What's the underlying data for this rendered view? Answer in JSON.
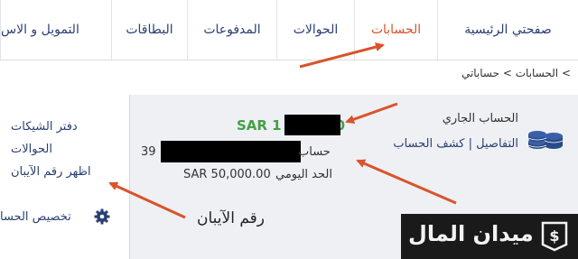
{
  "nav": {
    "items": [
      {
        "label": "صفحتي الرئيسية",
        "active": false
      },
      {
        "label": "الحسابات",
        "active": true
      },
      {
        "label": "الحوالات",
        "active": false
      },
      {
        "label": "المدفوعات",
        "active": false
      },
      {
        "label": "البطاقات",
        "active": false
      },
      {
        "label": "التمويل و الاس",
        "active": false
      }
    ]
  },
  "breadcrumb": {
    "text": "> الحسابات > حساباتي"
  },
  "account": {
    "name": "الحساب الجاري",
    "details_link": "التفاصيل",
    "separator": "|",
    "statement_link": "كشف الحساب",
    "balance_prefix": "SAR 1",
    "balance_suffix": "0",
    "number_prefix": "39",
    "number_label": "حساب",
    "daily_limit_amount": "SAR 50,000.00",
    "daily_limit_label": "الحد اليومي"
  },
  "side_links": {
    "checkbook": "دفتر الشيكات",
    "transfers": "الحوالات",
    "show_iban": "اظهر رقم الآيبان",
    "customize": "تخصيص الحسا"
  },
  "annotation": {
    "iban_note": "رقم الآيبان"
  },
  "logo": {
    "text": "ميدان المال",
    "badge_symbol": "$"
  },
  "colors": {
    "accent": "#d9542c",
    "nav_text": "#2a3f73",
    "balance": "#43a047",
    "arrow": "#d9542c"
  },
  "icons": {
    "account": "coins-stack-icon",
    "customize": "gear-icon",
    "logo": "dollar-badge-icon"
  }
}
